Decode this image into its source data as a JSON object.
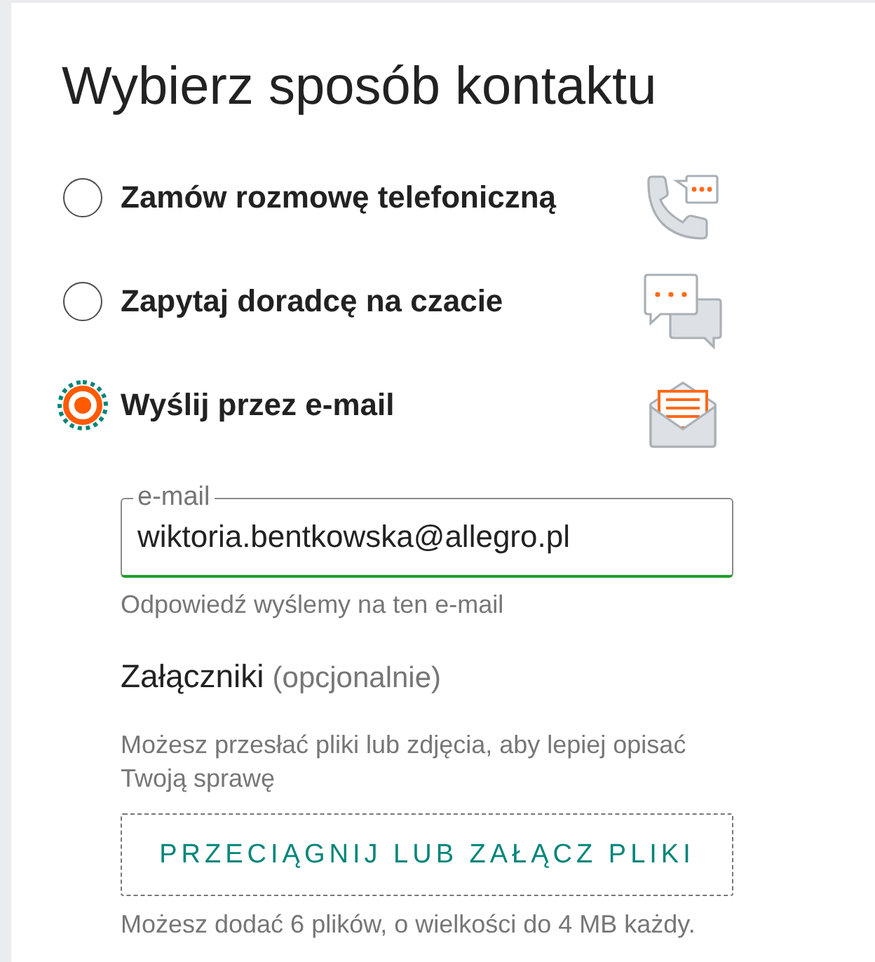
{
  "title": "Wybierz sposób kontaktu",
  "contact_options": [
    {
      "label": "Zamów rozmowę telefoniczną",
      "kind": "phone",
      "selected": false,
      "focused": false
    },
    {
      "label": "Zapytaj doradcę na czacie",
      "kind": "chat",
      "selected": false,
      "focused": false
    },
    {
      "label": "Wyślij przez e-mail",
      "kind": "email",
      "selected": true,
      "focused": true
    }
  ],
  "email_field": {
    "label": "e-mail",
    "value": "wiktoria.bentkowska@allegro.pl",
    "valid": true
  },
  "email_hint": "Odpowiedź wyślemy na ten e-mail",
  "attachments": {
    "heading": "Załączniki",
    "optional_note": "(opcjonalnie)",
    "description": "Możesz przesłać pliki lub zdjęcia, aby lepiej opisać Twoją sprawę",
    "dropzone_label": "PRZECIĄGNIJ LUB ZAŁĄCZ PLIKI",
    "limit_note": "Możesz dodać 6 plików, o wielkości do 4 MB każdy."
  }
}
